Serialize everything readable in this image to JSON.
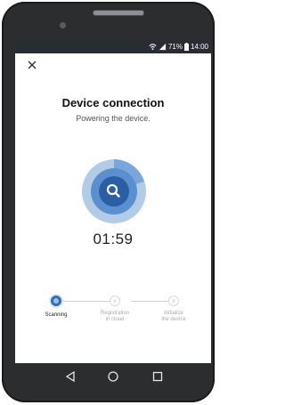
{
  "status_bar": {
    "battery_percent": "71%",
    "time": "14:00"
  },
  "header": {
    "title": "Device connection",
    "subtitle": "Powering the device."
  },
  "timer": "01:59",
  "steps": [
    {
      "label": "Scanning",
      "state": "active"
    },
    {
      "label": "Registration in cloud",
      "label_lines": [
        "Registration",
        "in cloud"
      ],
      "state": "pending"
    },
    {
      "label": "Initialize the device",
      "label_lines": [
        "Initialize",
        "the device"
      ],
      "state": "pending"
    }
  ],
  "icons": {
    "close": "close-icon",
    "scan": "search-icon",
    "back": "back-triangle-icon",
    "home": "home-circle-icon",
    "recents": "recents-square-icon",
    "wifi": "wifi-icon",
    "signal": "signal-icon",
    "battery": "battery-icon"
  },
  "colors": {
    "accent": "#2f6fb7",
    "scan_ring_outer": "#b3cce6",
    "scan_ring_mid": "#5b8fd0",
    "scan_center": "#2a5fa5",
    "status_bar_bg": "#2a2c33"
  }
}
